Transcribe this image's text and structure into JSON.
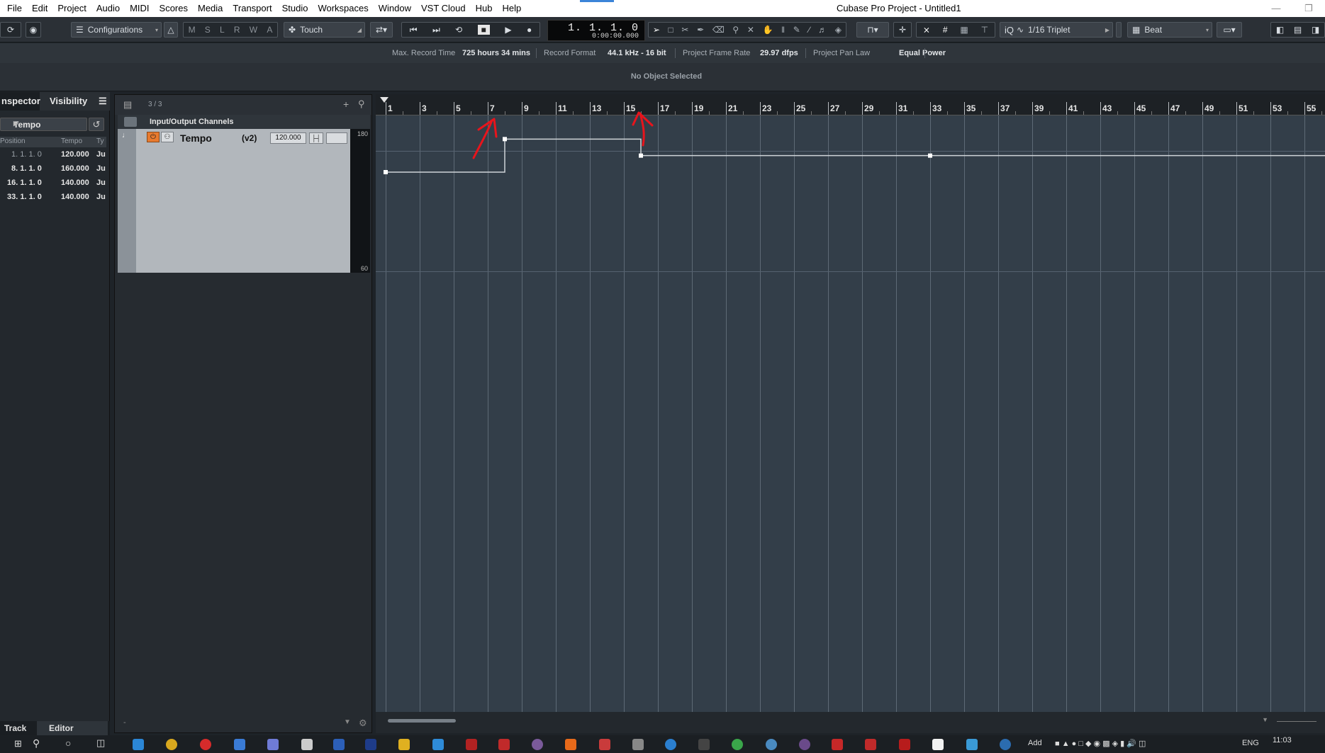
{
  "window": {
    "title": "Cubase Pro Project - Untitled1"
  },
  "menubar": {
    "items": [
      "File",
      "Edit",
      "Project",
      "Audio",
      "MIDI",
      "Scores",
      "Media",
      "Transport",
      "Studio",
      "Workspaces",
      "Window",
      "VST Cloud",
      "Hub",
      "Help"
    ]
  },
  "toolbar": {
    "configurations_label": "Configurations",
    "msrwa": [
      "M",
      "S",
      "L",
      "R",
      "W",
      "A"
    ],
    "automation_mode": "Touch",
    "counter_main": "1. 1. 1.   0",
    "counter_sub": "0:00:00.000",
    "quantize_label": "1/16 Triplet",
    "grid_type": "Beat",
    "iq_label": "iQ"
  },
  "infoline": {
    "max_record_time_label": "Max. Record Time",
    "max_record_time_value": "725 hours 34 mins",
    "record_format_label": "Record Format",
    "record_format_value": "44.1 kHz - 16 bit",
    "frame_rate_label": "Project Frame Rate",
    "frame_rate_value": "29.97 dfps",
    "pan_law_label": "Project Pan Law",
    "pan_law_value": "Equal Power",
    "object_status": "No Object Selected"
  },
  "inspector": {
    "tab_inspector": "nspector",
    "tab_visibility": "Visibility",
    "selected_track": "Tempo",
    "columns": [
      "Position",
      "Tempo",
      "Ty"
    ],
    "rows": [
      {
        "position": "1. 1. 1.   0",
        "tempo": "120.000",
        "type": "Ju"
      },
      {
        "position": "8. 1. 1.   0",
        "tempo": "160.000",
        "type": "Ju"
      },
      {
        "position": "16. 1. 1.   0",
        "tempo": "140.000",
        "type": "Ju"
      },
      {
        "position": "33. 1. 1.   0",
        "tempo": "140.000",
        "type": "Ju"
      }
    ],
    "bottom_tab_track": "Track",
    "bottom_tab_editor": "Editor"
  },
  "tracklist": {
    "count": "3 / 3",
    "folder_name": "Input/Output Channels",
    "tempo_track_name": "Tempo",
    "tempo_track_version": "(v2)",
    "tempo_value": "120.000",
    "scale_max": "180",
    "scale_min": "60"
  },
  "ruler": {
    "bars": [
      "1",
      "3",
      "5",
      "7",
      "9",
      "11",
      "13",
      "15",
      "17",
      "19",
      "21",
      "23",
      "25",
      "27",
      "29",
      "31",
      "33",
      "35",
      "37",
      "39",
      "41",
      "43",
      "45",
      "47",
      "49",
      "51",
      "53",
      "55"
    ]
  },
  "tempo_curve": {
    "range": [
      60,
      180
    ],
    "points": [
      {
        "bar": 1,
        "tempo": 120
      },
      {
        "bar": 8,
        "tempo": 160
      },
      {
        "bar": 16,
        "tempo": 140
      },
      {
        "bar": 33,
        "tempo": 140
      }
    ]
  },
  "taskbar": {
    "add_label": "Add",
    "language": "ENG",
    "clock": "11:03"
  },
  "colors": {
    "accent": "#3b84d8",
    "annotation_red": "#e8141c",
    "arrange_bg": "#333e49",
    "track_bg": "#b2b7bc"
  }
}
